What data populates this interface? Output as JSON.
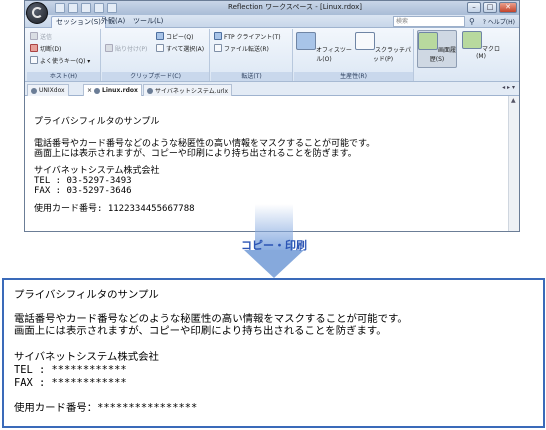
{
  "window": {
    "title": "Reflection ワークスペース - [Linux.rdox]",
    "controls": [
      "–",
      "□",
      "✕"
    ]
  },
  "quick_access": [
    "save-icon",
    "undo-icon",
    "redo-icon",
    "print-icon",
    "dropdown-icon"
  ],
  "ribbon_tabs": [
    "セッション(S)",
    "外観(A)",
    "ツール(L)"
  ],
  "search": {
    "placeholder": "検索"
  },
  "help_label": "? ヘルプ(H)",
  "ribbon": {
    "host": {
      "label": "ホスト(H)",
      "buttons": [
        "送信",
        "切断(D)",
        "よく使うキー(Q) ▾"
      ]
    },
    "clipboard": {
      "label": "クリップボード(C)",
      "buttons": [
        "貼り付け(P)",
        "コピー(Q)",
        "すべて選択(A)"
      ]
    },
    "transfer": {
      "label": "転送(T)",
      "buttons": [
        "FTP クライアント(T)",
        "ファイル転送(R)"
      ]
    },
    "productivity": {
      "label": "生産性(R)",
      "buttons": [
        "オフィスツール(O)",
        "スクラッチパッド(P)"
      ]
    },
    "screen_history": {
      "label": "画面履歴(S)"
    },
    "macro": {
      "label": "マクロ(M)"
    }
  },
  "doc_tabs": [
    "UNIXdox",
    "Linux.rdox",
    "サイバネットシステム.urlx"
  ],
  "terminal_lines": [
    "プライバシフィルタのサンプル",
    "電話番号やカード番号などのような秘匿性の高い情報をマスクすることが可能です。",
    "画面上には表示されますが、コピーや印刷により持ち出されることを防ぎます。",
    "サイバネットシステム株式会社",
    "TEL  :  03-5297-3493",
    "FAX  :  03-5297-3646",
    "使用カード番号:  1122334455667788"
  ],
  "arrow_label": "コピー・印刷",
  "result_lines": [
    "プライバシフィルタのサンプル",
    "電話番号やカード番号などのような秘匿性の高い情報をマスクすることが可能です。",
    "画面上には表示されますが、コピーや印刷により持ち出されることを防ぎます。",
    "サイバネットシステム株式会社",
    "TEL : ************",
    "FAX : ************",
    "使用カード番号：****************"
  ]
}
